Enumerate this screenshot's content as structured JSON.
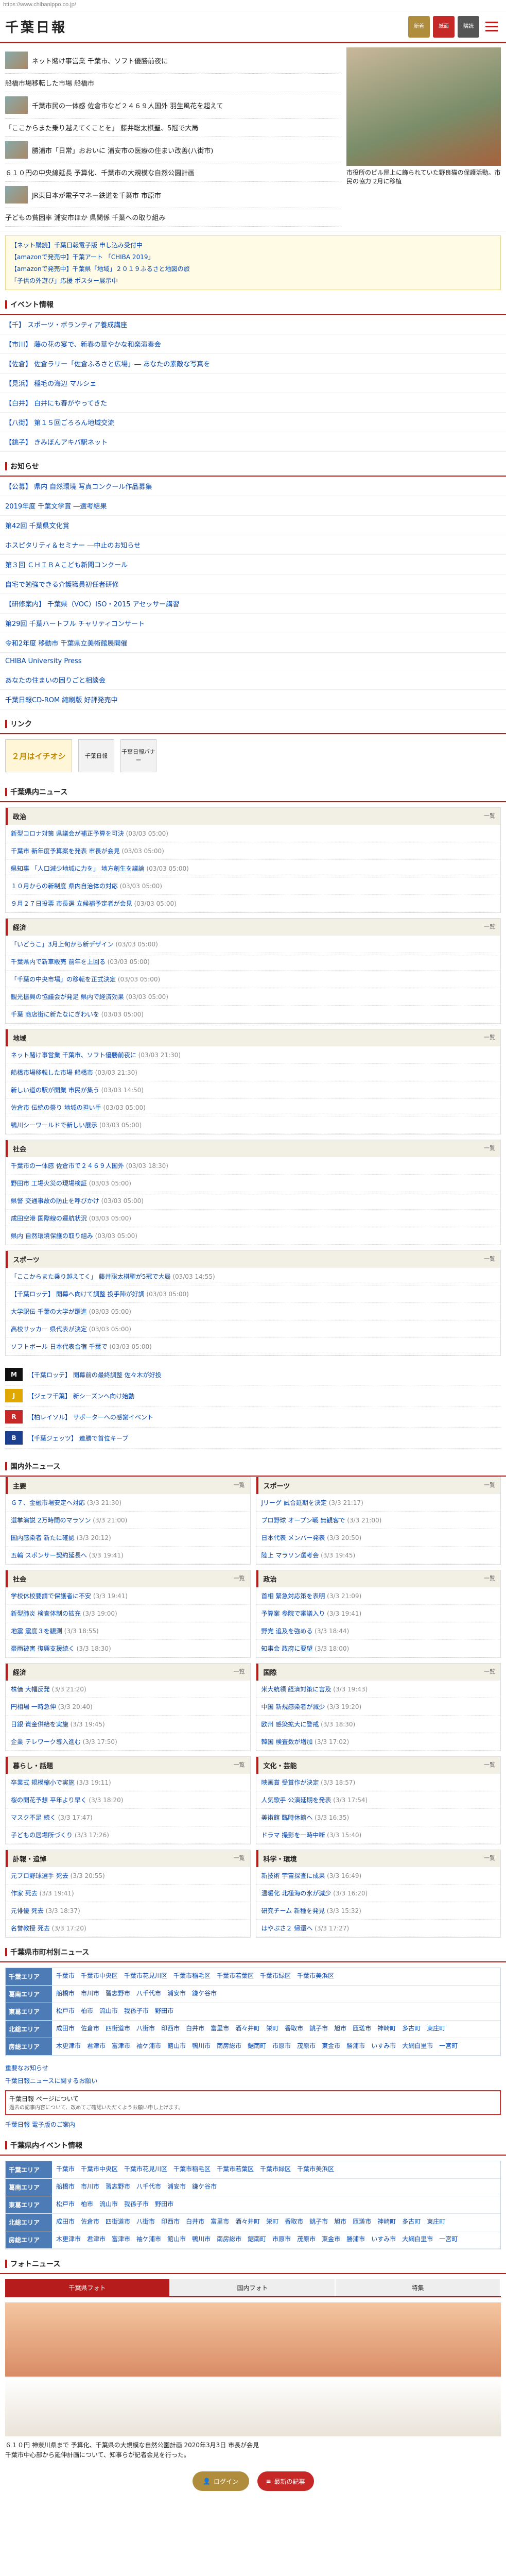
{
  "url": "https://www.chibanippo.co.jp/",
  "header": {
    "logo": "千葉日報",
    "btn_news": "新着",
    "btn_paper": "紙面",
    "btn_sub": "購読",
    "btn_login": "ログイン"
  },
  "top": {
    "items": [
      "ネット賭け事営業 千葉市、ソフト優勝前夜に",
      "船橋市場移転した市場 船橋市",
      "千葉市民の一体感 佐倉市など２４６９人国外 羽生風花を超えて",
      "「ここからまた乗り越えてくことを」 藤井聡太棋聖、5冠で大局",
      "勝浦市「日常」おおいに 浦安市の医療の住まい改善(八街市)",
      "６１０円の中央線延長 予算化、千葉市の大規模な自然公園計画",
      "JR東日本が電子マネー鉄道を千葉市 市原市",
      "子どもの貧困率 浦安市ほか 県関係 千葉への取り組み"
    ],
    "photo_caption": "市役所のビル屋上に飾られていた野良猫の保護活動。市民の協力 2月に移植"
  },
  "promo": [
    "【ネット購読】千葉日報電子版 申し込み受付中",
    "【amazonで発売中】千葉アート 「CHIBA 2019」",
    "【amazonで発売中】千葉県「地域」２０１９ふるさと地図の旅",
    "「子供の外遊び」応援 ポスター展示中"
  ],
  "event": {
    "title": "イベント情報",
    "items": [
      "【千】 スポーツ・ボランティア養成講座",
      "【市川】 藤の花の宴で、新春の華やかな和楽演奏会",
      "【佐倉】 佐倉ラリー「佐倉ふるさと広場」― あなたの素敵な写真を",
      "【見浜】 稲毛の海辺 マルシェ",
      "【白井】 白井にも春がやってきた",
      "【八街】 第１５回ごろろん地域交流",
      "【銚子】 きみぼんアキバ駅ネット"
    ]
  },
  "notice": {
    "title": "お知らせ",
    "items": [
      "【公募】 県内 自然環境 写真コンクール作品募集",
      "2019年度 千葉文学賞 ―選考結果",
      "第42回 千葉県文化賞",
      "ホスピタリティ＆セミナー ―中止のお知らせ",
      "第３回 ＣＨＩＢＡこども新聞コンクール",
      "自宅で勉強できる介護職員初任者研修",
      "【研修案内】 千葉県（VOC）ISO・2015 アセッサー講習",
      "第29回 千葉ハートフル チャリティコンサート",
      "令和2年度 移動市 千葉県立美術館展開催",
      "CHIBA University Press",
      "あなたの住まいの困りごと相談会",
      "千葉日報CD-ROM 縮刷版 好評発売中"
    ]
  },
  "link": {
    "title": "リンク",
    "banner1": "２月はイチオシ",
    "banner2": "千葉日報",
    "banner3": "千葉日報バナー"
  },
  "chiba_news": {
    "title": "千葉県内ニュース"
  },
  "cats": [
    {
      "name": "政治",
      "more": "一覧",
      "items": [
        [
          "新型コロナ対策 県議会が補正予算を可決",
          "(03/03 05:00)"
        ],
        [
          "千葉市 新年度予算案を発表 市長が会見",
          "(03/03 05:00)"
        ],
        [
          "県知事 「人口減少地域に力を」 地方創生を議論",
          "(03/03 05:00)"
        ],
        [
          "１０月からの新制度 県内自治体の対応",
          "(03/03 05:00)"
        ],
        [
          "９月２７日投票 市長選 立候補予定者が会見",
          "(03/03 05:00)"
        ]
      ]
    },
    {
      "name": "経済",
      "more": "一覧",
      "items": [
        [
          "「いどうこ」3月上旬から新デザイン",
          "(03/03 05:00)"
        ],
        [
          "千葉県内で新車販売 前年を上回る",
          "(03/03 05:00)"
        ],
        [
          "「千葉の中央市場」の移転を正式決定",
          "(03/03 05:00)"
        ],
        [
          "観光振興の協議会が発足 県内で経済効果",
          "(03/03 05:00)"
        ],
        [
          "千葉 商店街に新たなにぎわいを",
          "(03/03 05:00)"
        ]
      ]
    },
    {
      "name": "地域",
      "more": "一覧",
      "items": [
        [
          "ネット賭け事営業 千葉市、ソフト優勝前夜に",
          "(03/03 21:30)"
        ],
        [
          "船橋市場移転した市場 船橋市",
          "(03/03 21:30)"
        ],
        [
          "新しい道の駅が開業 市民が集う",
          "(03/03 14:50)"
        ],
        [
          "佐倉市 伝統の祭り 地域の担い手",
          "(03/03 05:00)"
        ],
        [
          "鴨川シーワールドで新しい展示",
          "(03/03 05:00)"
        ]
      ]
    },
    {
      "name": "社会",
      "more": "一覧",
      "items": [
        [
          "千葉市の一体感 佐倉市で２４６９人国外",
          "(03/03 18:30)"
        ],
        [
          "野田市 工場火災の現場検証",
          "(03/03 05:00)"
        ],
        [
          "県警 交通事故の防止を呼びかけ",
          "(03/03 05:00)"
        ],
        [
          "成田空港 国際線の運航状況",
          "(03/03 05:00)"
        ],
        [
          "県内 自然環境保護の取り組み",
          "(03/03 05:00)"
        ]
      ]
    },
    {
      "name": "スポーツ",
      "more": "一覧",
      "items": [
        [
          "「ここからまた乗り越えてく」 藤井聡太棋聖が5冠で大局",
          "(03/03 14:55)"
        ],
        [
          "【千葉ロッテ】 開幕へ向けて調整 投手陣が好調",
          "(03/03 05:00)"
        ],
        [
          "大学駅伝 千葉の大学が躍進",
          "(03/03 05:00)"
        ],
        [
          "高校サッカー 県代表が決定",
          "(03/03 05:00)"
        ],
        [
          "ソフトボール 日本代表合宿 千葉で",
          "(03/03 05:00)"
        ]
      ]
    }
  ],
  "teams": [
    {
      "logo": "M",
      "color": "#111",
      "text": "【千葉ロッテ】 開幕前の最終調整 佐々木が好投"
    },
    {
      "logo": "J",
      "color": "#e0a800",
      "text": "【ジェフ千葉】 新シーズンへ向け始動"
    },
    {
      "logo": "R",
      "color": "#c62828",
      "text": "【柏レイソル】 サポーターへの感謝イベント"
    },
    {
      "logo": "B",
      "color": "#1d3f8f",
      "text": "【千葉ジェッツ】 連勝で首位キープ"
    }
  ],
  "national_title": "国内外ニュース",
  "grid": [
    {
      "name": "主要",
      "more": "一覧",
      "items": [
        [
          "Ｇ７、金融市場安定へ対応",
          "(3/3 21:30)"
        ],
        [
          "選挙演説 2万時間のマラソン",
          "(3/3 21:00)"
        ],
        [
          "国内感染者 新たに確認",
          "(3/3 20:12)"
        ],
        [
          "五輪 スポンサー契約延長へ",
          "(3/3 19:41)"
        ]
      ]
    },
    {
      "name": "スポーツ",
      "more": "一覧",
      "items": [
        [
          "Jリーグ 試合延期を決定",
          "(3/3 21:17)"
        ],
        [
          "プロ野球 オープン戦 無観客で",
          "(3/3 21:00)"
        ],
        [
          "日本代表 メンバー発表",
          "(3/3 20:50)"
        ],
        [
          "陸上 マラソン選考会",
          "(3/3 19:45)"
        ]
      ]
    },
    {
      "name": "社会",
      "more": "一覧",
      "items": [
        [
          "学校休校要請で保護者に不安",
          "(3/3 19:41)"
        ],
        [
          "新型肺炎 検査体制の拡充",
          "(3/3 19:00)"
        ],
        [
          "地震 震度３を観測",
          "(3/3 18:55)"
        ],
        [
          "豪雨被害 復興支援続く",
          "(3/3 18:30)"
        ]
      ]
    },
    {
      "name": "政治",
      "more": "一覧",
      "items": [
        [
          "首相 緊急対応策を表明",
          "(3/3 21:09)"
        ],
        [
          "予算案 参院で審議入り",
          "(3/3 19:41)"
        ],
        [
          "野党 追及を強める",
          "(3/3 18:44)"
        ],
        [
          "知事会 政府に要望",
          "(3/3 18:00)"
        ]
      ]
    },
    {
      "name": "経済",
      "more": "一覧",
      "items": [
        [
          "株価 大幅反発",
          "(3/3 21:20)"
        ],
        [
          "円相場 一時急伸",
          "(3/3 20:40)"
        ],
        [
          "日銀 資金供給を実施",
          "(3/3 19:45)"
        ],
        [
          "企業 テレワーク導入進む",
          "(3/3 17:50)"
        ]
      ]
    },
    {
      "name": "国際",
      "more": "一覧",
      "items": [
        [
          "米大統領 経済対策に言及",
          "(3/3 19:43)"
        ],
        [
          "中国 新規感染者が減少",
          "(3/3 19:20)"
        ],
        [
          "欧州 感染拡大に警戒",
          "(3/3 18:30)"
        ],
        [
          "韓国 検査数が増加",
          "(3/3 17:02)"
        ]
      ]
    },
    {
      "name": "暮らし・話題",
      "more": "一覧",
      "items": [
        [
          "卒業式 規模縮小で実施",
          "(3/3 19:11)"
        ],
        [
          "桜の開花予想 平年より早く",
          "(3/3 18:20)"
        ],
        [
          "マスク不足 続く",
          "(3/3 17:47)"
        ],
        [
          "子どもの居場所づくり",
          "(3/3 17:26)"
        ]
      ]
    },
    {
      "name": "文化・芸能",
      "more": "一覧",
      "items": [
        [
          "映画賞 受賞作が決定",
          "(3/3 18:57)"
        ],
        [
          "人気歌手 公演延期を発表",
          "(3/3 17:54)"
        ],
        [
          "美術館 臨時休館へ",
          "(3/3 16:35)"
        ],
        [
          "ドラマ 撮影を一時中断",
          "(3/3 15:40)"
        ]
      ]
    },
    {
      "name": "訃報・追悼",
      "more": "一覧",
      "items": [
        [
          "元プロ野球選手 死去",
          "(3/3 20:55)"
        ],
        [
          "作家 死去",
          "(3/3 19:41)"
        ],
        [
          "元俳優 死去",
          "(3/3 18:37)"
        ],
        [
          "名誉教授 死去",
          "(3/3 17:20)"
        ]
      ]
    },
    {
      "name": "科学・環境",
      "more": "一覧",
      "items": [
        [
          "新技術 宇宙探査に成果",
          "(3/3 16:49)"
        ],
        [
          "温暖化 北極海の氷が減少",
          "(3/3 16:20)"
        ],
        [
          "研究チーム 新種を発見",
          "(3/3 15:32)"
        ],
        [
          "はやぶさ２ 帰還へ",
          "(3/3 17:27)"
        ]
      ]
    }
  ],
  "region_title": "千葉県市町村別ニュース",
  "regions": [
    {
      "name": "千葉エリア",
      "towns": [
        "千葉市",
        "千葉市中央区",
        "千葉市花見川区",
        "千葉市稲毛区",
        "千葉市若葉区",
        "千葉市緑区",
        "千葉市美浜区"
      ]
    },
    {
      "name": "葛南エリア",
      "towns": [
        "船橋市",
        "市川市",
        "習志野市",
        "八千代市",
        "浦安市",
        "鎌ケ谷市"
      ]
    },
    {
      "name": "東葛エリア",
      "towns": [
        "松戸市",
        "柏市",
        "流山市",
        "我孫子市",
        "野田市"
      ]
    },
    {
      "name": "北総エリア",
      "towns": [
        "成田市",
        "佐倉市",
        "四街道市",
        "八街市",
        "印西市",
        "白井市",
        "富里市",
        "酒々井町",
        "栄町",
        "香取市",
        "銚子市",
        "旭市",
        "匝瑳市",
        "神崎町",
        "多古町",
        "東庄町"
      ]
    },
    {
      "name": "房総エリア",
      "towns": [
        "木更津市",
        "君津市",
        "富津市",
        "袖ケ浦市",
        "館山市",
        "鴨川市",
        "南房総市",
        "鋸南町",
        "市原市",
        "茂原市",
        "東金市",
        "勝浦市",
        "いすみ市",
        "大網白里市",
        "一宮町"
      ]
    }
  ],
  "notices": {
    "n1": "重要なお知らせ",
    "n2": "千葉日報ニュースに関するお願い",
    "alert": "千葉日報 ページについて",
    "alert_sub": "過去の記事内容について、改めてご確認いただくようお願い申し上げます。",
    "n3": "千葉日報 電子版のご案内"
  },
  "event_region_title": "千葉県内イベント情報",
  "photo": {
    "title": "フォトニュース",
    "tabs": [
      "千葉県フォト",
      "国内フォト",
      "特集"
    ],
    "desc": "６１０円 神奈川県まで 予算化、千葉県の大規模な自然公園計画 2020年3月3日 市長が会見",
    "desc2": "千葉市中心部から延伸計画について、知事らが記者会見を行った。"
  },
  "footer": {
    "login": "ログイン",
    "newest": "最新の記事"
  }
}
